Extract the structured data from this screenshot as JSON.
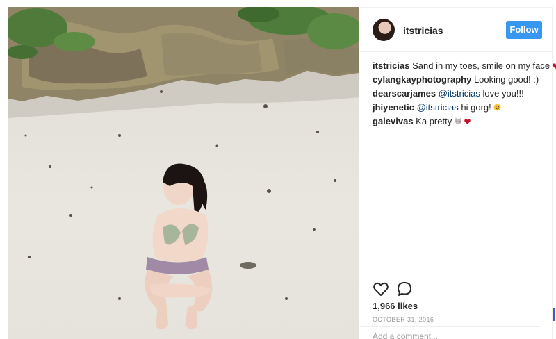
{
  "post": {
    "username": "itstricias",
    "follow_label": "Follow",
    "comments": [
      {
        "author": "itstricias",
        "text": "Sand in my toes, smile on my face",
        "mention": "",
        "emoji": "heart-icon"
      },
      {
        "author": "cylangkayphotography",
        "text": "Looking good! :)",
        "mention": "",
        "emoji": ""
      },
      {
        "author": "dearscarjames",
        "mention": "@itstricias",
        "text": "love you!!!",
        "emoji": ""
      },
      {
        "author": "jhiyenetic",
        "mention": "@itstricias",
        "text": "hi gorg!",
        "emoji": "smile-emoji-icon"
      },
      {
        "author": "galevivas",
        "text": "Ka pretty",
        "mention": "",
        "emoji": "cat-heart-icon"
      }
    ],
    "likes": "1,966 likes",
    "date": "OCTOBER 31, 2016",
    "add_comment_placeholder": "Add a comment..."
  },
  "icons": {
    "like": "heart-outline-icon",
    "comment": "speech-bubble-icon"
  },
  "colors": {
    "follow_button": "#3897f0",
    "mention": "#003569",
    "heart": "#c0102a"
  }
}
